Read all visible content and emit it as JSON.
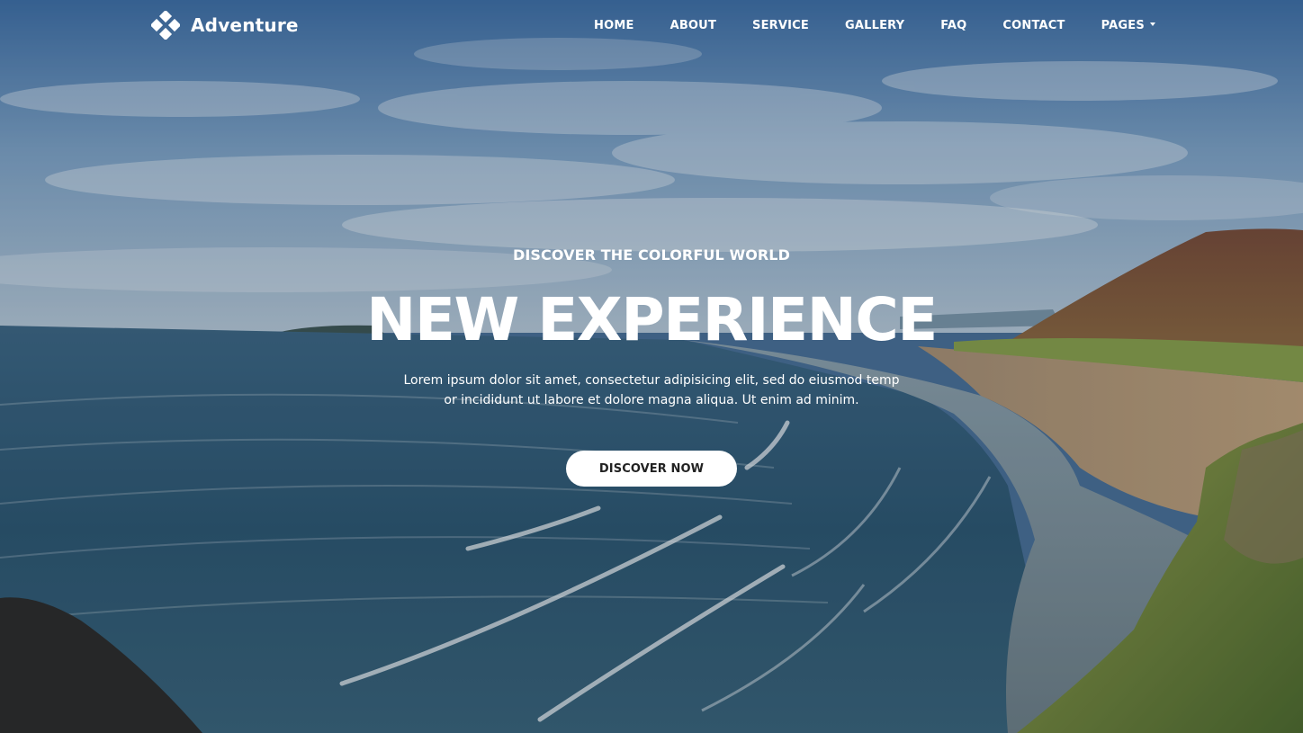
{
  "brand": {
    "name": "Adventure",
    "icon": "diamond-cluster-logo-icon"
  },
  "nav": {
    "items": [
      {
        "label": "HOME"
      },
      {
        "label": "ABOUT"
      },
      {
        "label": "SERVICE"
      },
      {
        "label": "GALLERY"
      },
      {
        "label": "FAQ"
      },
      {
        "label": "CONTACT"
      },
      {
        "label": "PAGES",
        "has_dropdown": true,
        "icon": "caret-down-icon"
      }
    ]
  },
  "hero": {
    "subtitle": "DISCOVER THE COLORFUL WORLD",
    "headline": "NEW EXPERIENCE",
    "lead_line1": "Lorem ipsum dolor sit amet, consectetur adipisicing elit, sed do eiusmod temp",
    "lead_line2": "or incididunt ut labore et dolore magna aliqua. Ut enim ad minim.",
    "cta_label": "DISCOVER NOW",
    "background": "coastal-beach-landscape-image"
  },
  "colors": {
    "text": "#ffffff",
    "button_bg": "#ffffff",
    "button_text": "#222222",
    "sky": "#5a86b8",
    "sea": "#2f5a78",
    "sand": "#b89a72",
    "hill": "#8a5a3a",
    "grass": "#6f8a3a"
  }
}
